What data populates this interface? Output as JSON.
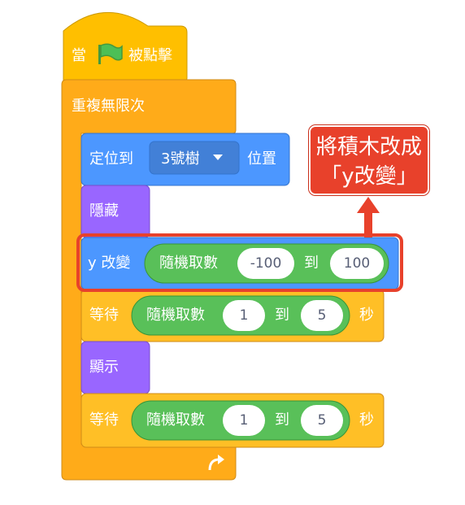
{
  "colors": {
    "events": "#ffbf00",
    "control": "#ffab19",
    "control_inner": "#ffbf26",
    "motion": "#4c97ff",
    "looks": "#9966ff",
    "operators": "#59c059",
    "callout": "#e8412b",
    "highlight": "#e8412b"
  },
  "hat_block": {
    "prefix": "當",
    "icon": "green-flag-icon",
    "suffix": "被點擊"
  },
  "forever_block": {
    "label": "重複無限次",
    "loop_icon": "loop-arrow-icon"
  },
  "go_to_block": {
    "prefix": "定位到",
    "dropdown_value": "3號樹",
    "suffix": "位置"
  },
  "hide_block": {
    "label": "隱藏"
  },
  "change_y_block": {
    "label": "y 改變",
    "random": {
      "label": "隨機取數",
      "from": "-100",
      "to_label": "到",
      "to": "100"
    }
  },
  "wait_block_1": {
    "label": "等待",
    "random": {
      "label": "隨機取數",
      "from": "1",
      "to_label": "到",
      "to": "5"
    },
    "unit": "秒"
  },
  "show_block": {
    "label": "顯示"
  },
  "wait_block_2": {
    "label": "等待",
    "random": {
      "label": "隨機取數",
      "from": "1",
      "to_label": "到",
      "to": "5"
    },
    "unit": "秒"
  },
  "callout": {
    "line1": "將積木改成",
    "line2": "「y改變」"
  }
}
